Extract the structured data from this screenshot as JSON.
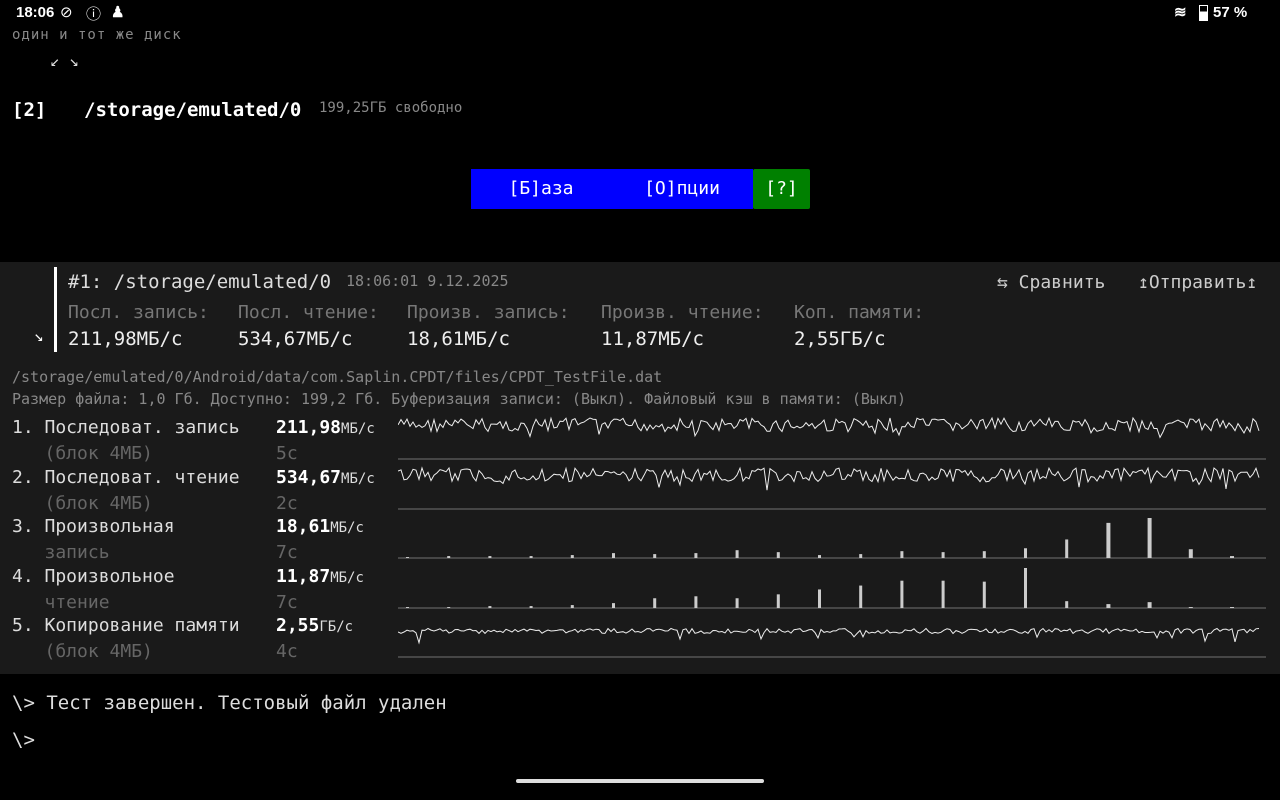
{
  "status_bar": {
    "time": "18:06",
    "battery": "57 %",
    "icons": [
      "check-circle-icon",
      "info-icon",
      "incognito-icon",
      "wifi-icon",
      "battery-icon"
    ]
  },
  "top": {
    "same_disk": "один и тот же диск",
    "arrows": "↙ ↘",
    "drive_index": "[2]",
    "drive_path": "/storage/emulated/0",
    "drive_free": "199,25ГБ свободно"
  },
  "buttons": {
    "base": "[Б]аза",
    "options": "[О]пции",
    "help": "[?]"
  },
  "colors": {
    "button_blue": "#0000ff",
    "help_green": "#008000",
    "panel_bg": "#1a1a1a"
  },
  "result": {
    "title": "#1: /storage/emulated/0",
    "timestamp": "18:06:01 9.12.2025",
    "compare": "⇆ Сравнить",
    "send": "↥Отправить↥",
    "collapse": "↘",
    "summary": [
      {
        "label": "Посл. запись:",
        "value": "211,98МБ/с"
      },
      {
        "label": "Посл. чтение:",
        "value": "534,67МБ/с"
      },
      {
        "label": "Произв. запись:",
        "value": "18,61МБ/с"
      },
      {
        "label": "Произв. чтение:",
        "value": "11,87МБ/с"
      },
      {
        "label": "Коп. памяти:",
        "value": "2,55ГБ/с"
      }
    ],
    "file_path": "/storage/emulated/0/Android/data/com.Saplin.CPDT/files/CPDT_TestFile.dat",
    "file_info": "Размер файла: 1,0 Гб. Доступно: 199,2 Гб. Буферизация записи: (Выкл). Файловый кэш в памяти: (Выкл)",
    "tests": [
      {
        "name": "1. Последоват. запись",
        "sub": "   (блок 4МБ)",
        "value": "211,98",
        "unit": "МБ/с",
        "time": "5с",
        "chart": "line"
      },
      {
        "name": "2. Последоват. чтение",
        "sub": "   (блок 4МБ)",
        "value": "534,67",
        "unit": "МБ/с",
        "time": "2с",
        "chart": "line"
      },
      {
        "name": "3. Произвольная",
        "sub": "   запись",
        "value": "18,61",
        "unit": "МБ/с",
        "time": "7с",
        "chart": "bar",
        "bars": [
          1,
          2,
          2,
          2,
          3,
          5,
          4,
          5,
          8,
          6,
          3,
          4,
          7,
          6,
          7,
          10,
          19,
          36,
          41,
          9,
          2
        ]
      },
      {
        "name": "4. Произвольное",
        "sub": "   чтение",
        "value": "11,87",
        "unit": "МБ/с",
        "time": "7с",
        "chart": "bar",
        "bars": [
          1,
          1,
          2,
          2,
          3,
          5,
          10,
          12,
          10,
          14,
          19,
          23,
          28,
          28,
          27,
          41,
          7,
          4,
          6,
          1,
          1
        ]
      },
      {
        "name": "5. Копирование памяти",
        "sub": "   (блок 4МБ)",
        "value": "2,55",
        "unit": "ГБ/с",
        "time": "4с",
        "chart": "line"
      }
    ]
  },
  "console": {
    "line1": "\\> Тест завершен. Тестовый файл удален",
    "prompt": "\\>"
  }
}
